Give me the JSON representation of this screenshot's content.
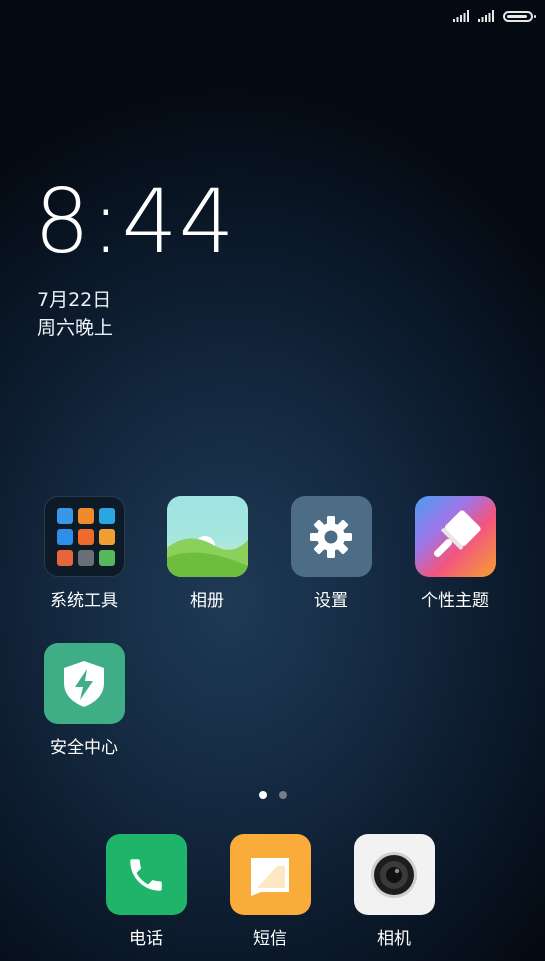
{
  "status_bar": {
    "battery_level": 0.9
  },
  "lockscreen": {
    "time": "8:44",
    "date": "7月22日",
    "weekday_time": "周六晚上"
  },
  "apps": [
    {
      "label": "系统工具",
      "icon": "folder-icon"
    },
    {
      "label": "相册",
      "icon": "gallery-icon"
    },
    {
      "label": "设置",
      "icon": "gear-icon"
    },
    {
      "label": "个性主题",
      "icon": "theme-brush-icon"
    },
    {
      "label": "安全中心",
      "icon": "shield-lightning-icon"
    }
  ],
  "folder_mini_colors": [
    "#3b96e6",
    "#f08a2a",
    "#2aa7e0",
    "#2f8fe8",
    "#f06a2a",
    "#f0a030",
    "#e8653a",
    "#6a6f77",
    "#55b85c"
  ],
  "pager": {
    "pages": 2,
    "current": 1
  },
  "dock": [
    {
      "label": "电话",
      "icon": "phone-icon"
    },
    {
      "label": "短信",
      "icon": "message-icon"
    },
    {
      "label": "相机",
      "icon": "camera-icon"
    }
  ]
}
